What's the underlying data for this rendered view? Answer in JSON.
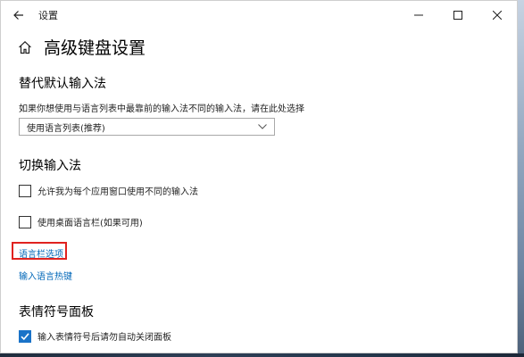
{
  "window": {
    "title": "设置"
  },
  "header": {
    "page_title": "高级键盘设置"
  },
  "override_section": {
    "title": "替代默认输入法",
    "description": "如果你想使用与语言列表中最靠前的输入法不同的输入法，请在此处选择",
    "dropdown_value": "使用语言列表(推荐)"
  },
  "switch_section": {
    "title": "切换输入法",
    "options": [
      {
        "label": "允许我为每个应用窗口使用不同的输入法",
        "checked": false
      },
      {
        "label": "使用桌面语言栏(如果可用)",
        "checked": false
      }
    ],
    "links": [
      "语言栏选项",
      "输入语言热键"
    ]
  },
  "emoji_section": {
    "title": "表情符号面板",
    "options": [
      {
        "label": "输入表情符号后请勿自动关闭面板",
        "checked": true
      }
    ]
  },
  "colors": {
    "accent": "#0067b8",
    "checkbox_checked": "#1a73c8",
    "highlight": "#e0221f"
  }
}
